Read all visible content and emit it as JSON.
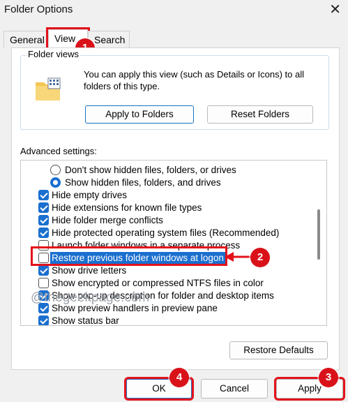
{
  "window": {
    "title": "Folder Options",
    "close_glyph": "✕"
  },
  "tabs": [
    {
      "label": "General"
    },
    {
      "label": "View"
    },
    {
      "label": "Search"
    }
  ],
  "folder_views": {
    "legend": "Folder views",
    "description": "You can apply this view (such as Details or Icons) to all folders of this type.",
    "apply_label": "Apply to Folders",
    "reset_label": "Reset Folders"
  },
  "advanced": {
    "label": "Advanced settings:",
    "items": [
      {
        "type": "radio",
        "checked": false,
        "label": "Don't show hidden files, folders, or drives"
      },
      {
        "type": "radio",
        "checked": true,
        "label": "Show hidden files, folders, and drives"
      },
      {
        "type": "checkbox",
        "checked": true,
        "label": "Hide empty drives"
      },
      {
        "type": "checkbox",
        "checked": true,
        "label": "Hide extensions for known file types"
      },
      {
        "type": "checkbox",
        "checked": true,
        "label": "Hide folder merge conflicts"
      },
      {
        "type": "checkbox",
        "checked": true,
        "label": "Hide protected operating system files (Recommended)"
      },
      {
        "type": "checkbox",
        "checked": false,
        "label": "Launch folder windows in a separate process"
      },
      {
        "type": "checkbox",
        "checked": false,
        "label": "Restore previous folder windows at logon"
      },
      {
        "type": "checkbox",
        "checked": true,
        "label": "Show drive letters"
      },
      {
        "type": "checkbox",
        "checked": false,
        "label": "Show encrypted or compressed NTFS files in color"
      },
      {
        "type": "checkbox",
        "checked": true,
        "label": "Show pop-up description for folder and desktop items"
      },
      {
        "type": "checkbox",
        "checked": true,
        "label": "Show preview handlers in preview pane"
      },
      {
        "type": "checkbox",
        "checked": true,
        "label": "Show status bar"
      }
    ]
  },
  "restore_defaults_label": "Restore Defaults",
  "watermark": "@thegeekpage.com",
  "footer": {
    "ok_label": "OK",
    "cancel_label": "Cancel",
    "apply_label": "Apply"
  },
  "annotations": {
    "step1": "1",
    "step2": "2",
    "step3": "3",
    "step4": "4"
  },
  "colors": {
    "accent": "#1a6fcf",
    "annotation_red": "#e3121b"
  }
}
